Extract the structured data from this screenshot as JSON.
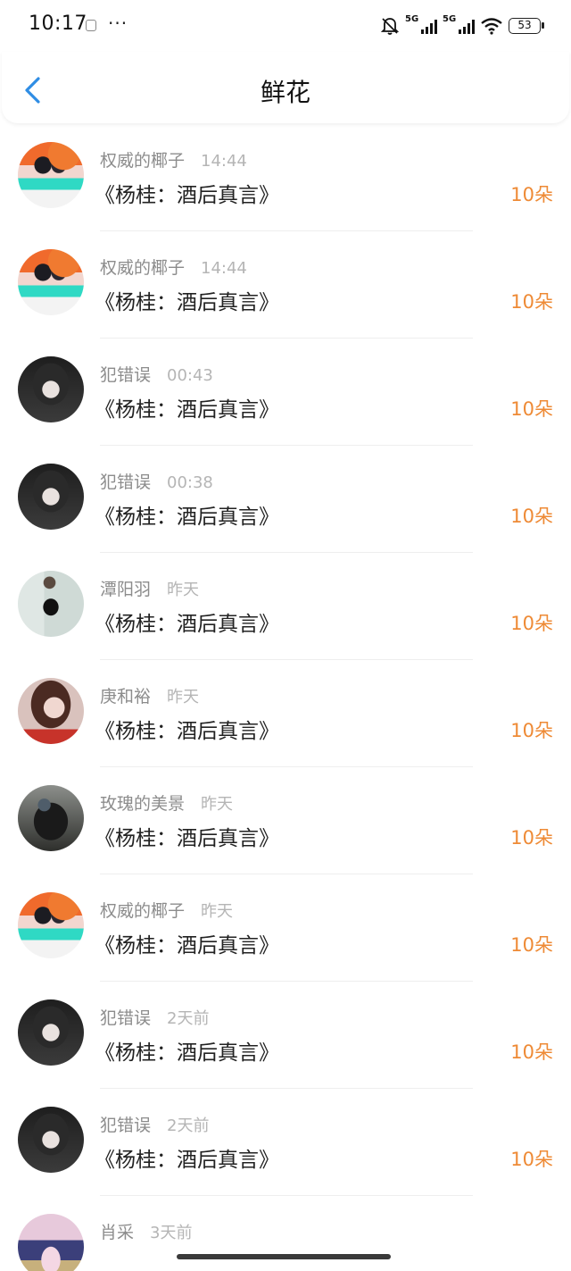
{
  "status": {
    "time": "10:17",
    "dots": "···",
    "network1": "5G",
    "network2": "5G",
    "battery": "53"
  },
  "header": {
    "title": "鲜花"
  },
  "colors": {
    "accent": "#ee8a35",
    "back": "#2f8de4"
  },
  "items": [
    {
      "name": "权威的椰子",
      "time": "14:44",
      "book": "《杨桂：酒后真言》",
      "count": "10朵",
      "avatar": "av-a"
    },
    {
      "name": "权威的椰子",
      "time": "14:44",
      "book": "《杨桂：酒后真言》",
      "count": "10朵",
      "avatar": "av-a"
    },
    {
      "name": "犯错误",
      "time": "00:43",
      "book": "《杨桂：酒后真言》",
      "count": "10朵",
      "avatar": "av-b"
    },
    {
      "name": "犯错误",
      "time": "00:38",
      "book": "《杨桂：酒后真言》",
      "count": "10朵",
      "avatar": "av-b"
    },
    {
      "name": "潭阳羽",
      "time": "昨天",
      "book": "《杨桂：酒后真言》",
      "count": "10朵",
      "avatar": "av-c"
    },
    {
      "name": "庚和裕",
      "time": "昨天",
      "book": "《杨桂：酒后真言》",
      "count": "10朵",
      "avatar": "av-d"
    },
    {
      "name": "玫瑰的美景",
      "time": "昨天",
      "book": "《杨桂：酒后真言》",
      "count": "10朵",
      "avatar": "av-e"
    },
    {
      "name": "权威的椰子",
      "time": "昨天",
      "book": "《杨桂：酒后真言》",
      "count": "10朵",
      "avatar": "av-a"
    },
    {
      "name": "犯错误",
      "time": "2天前",
      "book": "《杨桂：酒后真言》",
      "count": "10朵",
      "avatar": "av-b"
    },
    {
      "name": "犯错误",
      "time": "2天前",
      "book": "《杨桂：酒后真言》",
      "count": "10朵",
      "avatar": "av-b"
    },
    {
      "name": "肖采",
      "time": "3天前",
      "book": "",
      "count": "",
      "avatar": "av-f"
    }
  ]
}
